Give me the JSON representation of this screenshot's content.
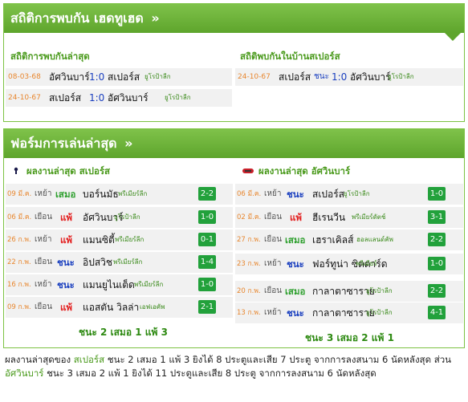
{
  "h2h": {
    "title": "สถิติการพบกัน เฮดทูเฮด",
    "title_chev": "»",
    "left": {
      "heading": "สถิติการพบกันล่าสุด",
      "rows": [
        {
          "date": "08-03-68",
          "home": "อัศวินบาร์",
          "score": "1:0",
          "away": "สเปอร์ส",
          "comp": "ยูโรป้าลีก"
        },
        {
          "date": "24-10-67",
          "home": "สเปอร์ส",
          "score": "1:0",
          "away": "อัศวินบาร์",
          "comp": "ยูโรป้าลีก"
        }
      ]
    },
    "right": {
      "heading": "สถิติพบกันในบ้านสเปอร์ส",
      "rows": [
        {
          "date": "24-10-67",
          "home": "สเปอร์ส",
          "result": "ชนะ",
          "score": "1:0",
          "away": "อัศวินบาร์",
          "comp": "ยูโรป้าลีก"
        }
      ]
    }
  },
  "form": {
    "title": "ฟอร์มการเล่นล่าสุด",
    "title_chev": "»",
    "spurs": {
      "heading": "ผลงานล่าสุด สเปอร์ส",
      "rows": [
        {
          "date": "09 มี.ค.",
          "venue": "เหย้า",
          "result": "เสมอ",
          "kind": "d",
          "opp": "บอร์นมัธ",
          "comp": "พรีเมียร์ลีก",
          "score": "2-2"
        },
        {
          "date": "06 มี.ค.",
          "venue": "เยือน",
          "result": "แพ้",
          "kind": "l",
          "opp": "อัศวินบาร์",
          "comp": "ยูโรป้าลีก",
          "score": "1-0"
        },
        {
          "date": "26 ก.พ.",
          "venue": "เหย้า",
          "result": "แพ้",
          "kind": "l",
          "opp": "แมนซิตี้",
          "comp": "พรีเมียร์ลีก",
          "score": "0-1"
        },
        {
          "date": "22 ก.พ.",
          "venue": "เยือน",
          "result": "ชนะ",
          "kind": "w",
          "opp": "อิปสวิช",
          "comp": "พรีเมียร์ลีก",
          "score": "1-4"
        },
        {
          "date": "16 ก.พ.",
          "venue": "เหย้า",
          "result": "ชนะ",
          "kind": "w",
          "opp": "แมนยูไนเต็ด",
          "comp": "พรีเมียร์ลีก",
          "score": "1-0"
        },
        {
          "date": "09 ก.พ.",
          "venue": "เยือน",
          "result": "แพ้",
          "kind": "l",
          "opp": "แอสตัน วิลล่า",
          "comp": "เอฟเอคัพ",
          "score": "2-1"
        }
      ],
      "summary": "ชนะ 2 เสมอ 1 แพ้ 3"
    },
    "az": {
      "heading": "ผลงานล่าสุด อัศวินบาร์",
      "rows": [
        {
          "date": "06 มี.ค.",
          "venue": "เหย้า",
          "result": "ชนะ",
          "kind": "w",
          "opp": "สเปอร์ส",
          "opp2": "",
          "comp": "ยูโรป้าลีก",
          "score": "1-0"
        },
        {
          "date": "02 มี.ค.",
          "venue": "เยือน",
          "result": "แพ้",
          "kind": "l",
          "opp": "ฮีเรนวีน",
          "opp2": "",
          "comp": "พรีเมียร์ดัตช์",
          "score": "3-1"
        },
        {
          "date": "27 ก.พ.",
          "venue": "เยือน",
          "result": "เสมอ",
          "kind": "d",
          "opp": "เฮราเคิลส์",
          "opp2": "",
          "comp": "ฮอลแลนด์คัพ",
          "score": "2-2"
        },
        {
          "date": "23 ก.พ.",
          "venue": "เหย้า",
          "result": "ชนะ",
          "kind": "w",
          "opp": "ฟอร์ทูน่า ซิตตาร์ด",
          "opp2": "ดัตช์",
          "comp": "พรีเมียร์",
          "score": "1-0"
        },
        {
          "date": "20 ก.พ.",
          "venue": "เยือน",
          "result": "เสมอ",
          "kind": "d",
          "opp": "กาลาตาซาราย",
          "opp2": "",
          "comp": "ยูโรป้าลีก",
          "score": "2-2"
        },
        {
          "date": "13 ก.พ.",
          "venue": "เหย้า",
          "result": "ชนะ",
          "kind": "w",
          "opp": "กาลาตาซาราย",
          "opp2": "",
          "comp": "ยูโรป้าลีก",
          "score": "4-1"
        }
      ],
      "summary": "ชนะ 3 เสมอ 2 แพ้ 1"
    }
  },
  "footer": {
    "p1": "ผลงานล่าสุดของ ",
    "team1": "สเปอร์ส",
    "p2": " ชนะ 2 เสมอ 1 แพ้ 3 ยิงได้ 8 ประตูและเสีย 7 ประตู จากการลงสนาม 6 นัดหลังสุด ส่วน",
    "team2": "อัศวินบาร์",
    "p3": " ชนะ 3 เสมอ 2 แพ้ 1 ยิงได้ 11 ประตูและเสีย 8 ประตู จากการลงสนาม 6 นัดหลังสุด"
  },
  "colors": {
    "accent": "#6cb43a",
    "win": "#1a3fbf",
    "loss": "#e32020",
    "draw": "#2d9f2d",
    "badge": "#22a13b",
    "date": "#e8872f"
  }
}
